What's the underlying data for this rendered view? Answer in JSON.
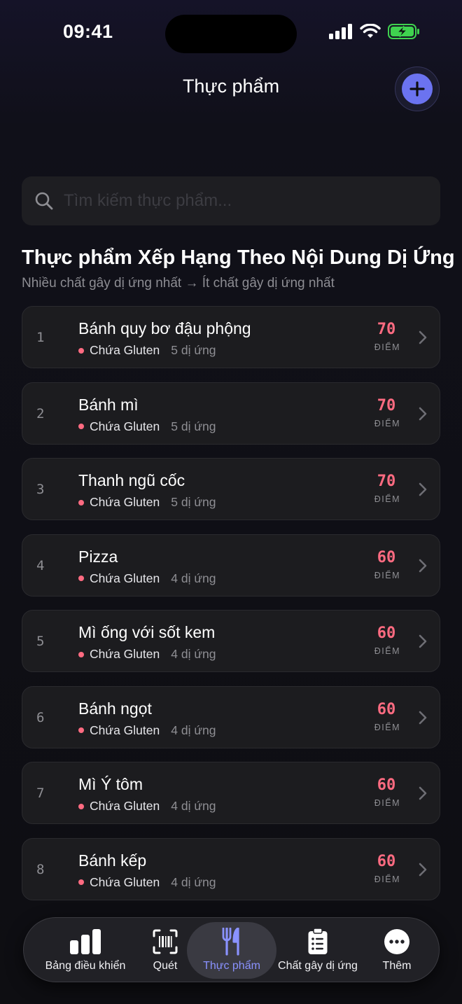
{
  "status": {
    "time": "09:41"
  },
  "header": {
    "title": "Thực phẩm"
  },
  "search": {
    "placeholder": "Tìm kiếm thực phẩm..."
  },
  "section": {
    "title": "Thực phẩm Xếp Hạng Theo Nội Dung Dị Ứng",
    "subtitle": "Nhiều chất gây dị ứng nhất → Ít chất gây dị ứng nhất"
  },
  "score_unit": "ĐIỂM",
  "foods": [
    {
      "rank": "1",
      "name": "Bánh quy bơ đậu phộng",
      "tag": "Chứa Gluten",
      "count": "5 dị ứng",
      "score": "70"
    },
    {
      "rank": "2",
      "name": "Bánh mì",
      "tag": "Chứa Gluten",
      "count": "5 dị ứng",
      "score": "70"
    },
    {
      "rank": "3",
      "name": "Thanh ngũ cốc",
      "tag": "Chứa Gluten",
      "count": "5 dị ứng",
      "score": "70"
    },
    {
      "rank": "4",
      "name": "Pizza",
      "tag": "Chứa Gluten",
      "count": "4 dị ứng",
      "score": "60"
    },
    {
      "rank": "5",
      "name": "Mì ống với sốt kem",
      "tag": "Chứa Gluten",
      "count": "4 dị ứng",
      "score": "60"
    },
    {
      "rank": "6",
      "name": "Bánh ngọt",
      "tag": "Chứa Gluten",
      "count": "4 dị ứng",
      "score": "60"
    },
    {
      "rank": "7",
      "name": "Mì Ý tôm",
      "tag": "Chứa Gluten",
      "count": "4 dị ứng",
      "score": "60"
    },
    {
      "rank": "8",
      "name": "Bánh kếp",
      "tag": "Chứa Gluten",
      "count": "4 dị ứng",
      "score": "60"
    }
  ],
  "tabs": [
    {
      "label": "Bảng điều khiển",
      "icon": "chart-bars-icon"
    },
    {
      "label": "Quét",
      "icon": "barcode-scan-icon"
    },
    {
      "label": "Thực phẩm",
      "icon": "fork-knife-icon",
      "active": true
    },
    {
      "label": "Chất gây dị ứng",
      "icon": "clipboard-list-icon"
    },
    {
      "label": "Thêm",
      "icon": "more-dots-icon"
    }
  ],
  "colors": {
    "accent": "#6b73f0",
    "score": "#ff6b81",
    "active_tab": "#8a92ff"
  }
}
